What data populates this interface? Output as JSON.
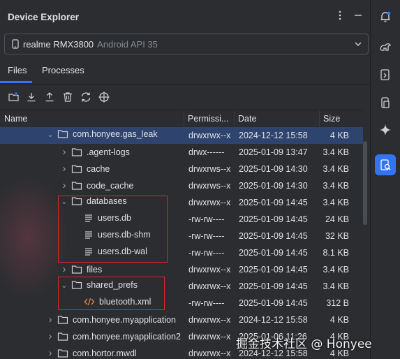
{
  "window": {
    "title": "Device Explorer"
  },
  "device": {
    "name": "realme RMX3800",
    "sub": "Android API 35"
  },
  "tabs": [
    {
      "label": "Files",
      "active": true
    },
    {
      "label": "Processes",
      "active": false
    }
  ],
  "toolbar": [
    "new-folder-icon",
    "download-icon",
    "upload-icon",
    "delete-icon",
    "sync-icon",
    "locate-icon"
  ],
  "table": {
    "headers": {
      "name": "Name",
      "permissions": "Permissi...",
      "date": "Date",
      "size": "Size"
    },
    "rows": [
      {
        "name": "com.honyee.gas_leak",
        "type": "folder",
        "expanded": true,
        "indent": 0,
        "perm": "drwxrwx--x",
        "date": "2024-12-12 15:58",
        "size": "4 KB",
        "selected": true
      },
      {
        "name": ".agent-logs",
        "type": "folder",
        "expanded": false,
        "indent": 1,
        "perm": "drwx------",
        "date": "2025-01-09 13:47",
        "size": "3.4 KB"
      },
      {
        "name": "cache",
        "type": "folder",
        "expanded": false,
        "indent": 1,
        "perm": "drwxrws--x",
        "date": "2025-01-09 14:30",
        "size": "3.4 KB"
      },
      {
        "name": "code_cache",
        "type": "folder",
        "expanded": false,
        "indent": 1,
        "perm": "drwxrws--x",
        "date": "2025-01-09 14:30",
        "size": "3.4 KB"
      },
      {
        "name": "databases",
        "type": "folder",
        "expanded": true,
        "indent": 1,
        "perm": "drwxrwx--x",
        "date": "2025-01-09 14:45",
        "size": "3.4 KB"
      },
      {
        "name": "users.db",
        "type": "file",
        "indent": 2,
        "perm": "-rw-rw----",
        "date": "2025-01-09 14:45",
        "size": "24 KB"
      },
      {
        "name": "users.db-shm",
        "type": "file",
        "indent": 2,
        "perm": "-rw-rw----",
        "date": "2025-01-09 14:45",
        "size": "32 KB"
      },
      {
        "name": "users.db-wal",
        "type": "file",
        "indent": 2,
        "perm": "-rw-rw----",
        "date": "2025-01-09 14:45",
        "size": "8.1 KB"
      },
      {
        "name": "files",
        "type": "folder",
        "expanded": false,
        "indent": 1,
        "perm": "drwxrwx--x",
        "date": "2025-01-09 14:45",
        "size": "3.4 KB"
      },
      {
        "name": "shared_prefs",
        "type": "folder",
        "expanded": true,
        "indent": 1,
        "perm": "drwxrwx--x",
        "date": "2025-01-09 14:45",
        "size": "3.4 KB"
      },
      {
        "name": "bluetooth.xml",
        "type": "xml",
        "indent": 2,
        "perm": "-rw-rw----",
        "date": "2025-01-09 14:45",
        "size": "312 B"
      },
      {
        "name": "com.honyee.myapplication",
        "type": "folder",
        "expanded": false,
        "indent": -1,
        "perm": "drwxrwx--x",
        "date": "2024-12-12 15:58",
        "size": "4 KB"
      },
      {
        "name": "com.honyee.myapplication2",
        "type": "folder",
        "expanded": false,
        "indent": -1,
        "perm": "drwxrwx--x",
        "date": "2025-01-06 11:26",
        "size": "4 KB"
      },
      {
        "name": "com.hortor.mwdl",
        "type": "folder",
        "expanded": false,
        "indent": -1,
        "perm": "drwxrwx--x",
        "date": "2024-12-12 15:58",
        "size": "4 KB"
      }
    ]
  },
  "sidebar": [
    "notifications-icon",
    "gradle-icon",
    "logcat-icon",
    "device-manager-icon",
    "gemini-icon",
    "device-explorer-icon"
  ],
  "watermark": "掘金技术社区 @ Honyee",
  "colors": {
    "accent": "#3574f0",
    "highlight": "#e0262b",
    "selected_row": "#2e436e"
  }
}
